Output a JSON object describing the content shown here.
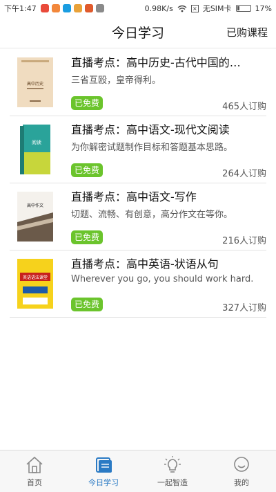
{
  "status": {
    "time": "下午1:47",
    "speed": "0.98K/s",
    "sim": "无SIM卡",
    "battery_percent": 17,
    "battery_label": "17%",
    "app_colors": [
      "#e94a3a",
      "#f2873b",
      "#1a9de1",
      "#e9a23a",
      "#e05a2c",
      "#8a8a8a"
    ]
  },
  "header": {
    "title": "今日学习",
    "purchased_label": "已购课程"
  },
  "courses": [
    {
      "title": "直播考点：高中历史-古代中国的…",
      "desc": "三省互殴，皇帝得利。",
      "badge": "已免费",
      "subs": "465人订购",
      "cover_title": "高中历史"
    },
    {
      "title": "直播考点：高中语文-现代文阅读",
      "desc": "为你解密试题制作目标和答题基本思路。",
      "badge": "已免费",
      "subs": "264人订购",
      "cover_title": "阅读"
    },
    {
      "title": "直播考点：高中语文-写作",
      "desc": "切题、流畅、有创意，高分作文在等你。",
      "badge": "已免费",
      "subs": "216人订购",
      "cover_title": "高中作文"
    },
    {
      "title": "直播考点：高中英语-状语从句",
      "desc": "Wherever you go, you should work hard.",
      "badge": "已免费",
      "subs": "327人订购",
      "cover_title": "英语语法课堂"
    }
  ],
  "tabs": [
    {
      "label": "首页",
      "icon": "home-icon"
    },
    {
      "label": "今日学习",
      "icon": "book-icon"
    },
    {
      "label": "一起智造",
      "icon": "bulb-icon"
    },
    {
      "label": "我的",
      "icon": "profile-icon"
    }
  ],
  "colors": {
    "badge": "#6bc42c",
    "active_tab": "#2a7ac4"
  }
}
